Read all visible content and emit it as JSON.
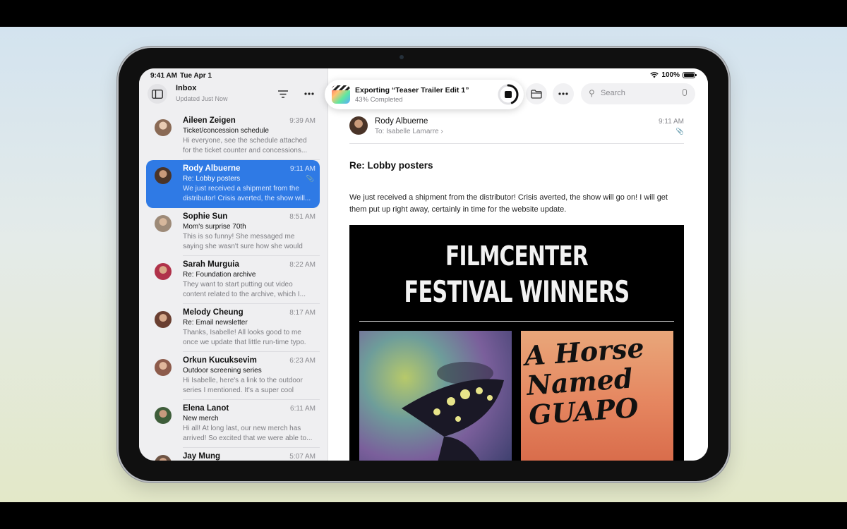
{
  "status": {
    "time": "9:41 AM",
    "date": "Tue Apr 1",
    "battery": "100%"
  },
  "sidebar": {
    "title": "Inbox",
    "subtitle": "Updated Just Now",
    "icons": {
      "sidebar_toggle": "sidebar-icon",
      "filter": "filter-icon",
      "more": "ellipsis-icon"
    }
  },
  "mails": [
    {
      "sender": "Aileen Zeigen",
      "time": "9:39 AM",
      "subject": "Ticket/concession schedule",
      "preview": "Hi everyone, see the schedule attached for the ticket counter and concessions...",
      "avatar_color": "#8a6a55",
      "selected": false,
      "attachment": false
    },
    {
      "sender": "Rody Albuerne",
      "time": "9:11 AM",
      "subject": "Re: Lobby posters",
      "preview": "We just received a shipment from the distributor! Crisis averted, the show will...",
      "avatar_color": "#6b4b3a",
      "selected": true,
      "attachment": true
    },
    {
      "sender": "Sophie Sun",
      "time": "8:51 AM",
      "subject": "Mom's surprise 70th",
      "preview": "This is so funny! She messaged me saying she wasn't sure how she would spend...",
      "avatar_color": "#b9a38d",
      "selected": false,
      "attachment": false
    },
    {
      "sender": "Sarah Murguia",
      "time": "8:22 AM",
      "subject": "Re: Foundation archive",
      "preview": "They want to start putting out video content related to the archive, which I...",
      "avatar_color": "#b0324a",
      "selected": false,
      "attachment": false
    },
    {
      "sender": "Melody Cheung",
      "time": "8:17 AM",
      "subject": "Re: Email newsletter",
      "preview": "Thanks, Isabelle! All looks good to me once we update that little run-time typo.",
      "avatar_color": "#7a4e3e",
      "selected": false,
      "attachment": false
    },
    {
      "sender": "Orkun Kucuksevim",
      "time": "6:23 AM",
      "subject": "Outdoor screening series",
      "preview": "Hi Isabelle, here's a link to the outdoor series I mentioned. It's a super cool initia...",
      "avatar_color": "#9b6a5a",
      "selected": false,
      "attachment": false
    },
    {
      "sender": "Elena Lanot",
      "time": "6:11 AM",
      "subject": "New merch",
      "preview": "Hi all! At long last, our new merch has arrived! So excited that we were able to...",
      "avatar_color": "#3e5d3a",
      "selected": false,
      "attachment": false
    },
    {
      "sender": "Jay Mung",
      "time": "5:07 AM",
      "subject": "",
      "preview": "",
      "avatar_color": "#6e5445",
      "selected": false,
      "attachment": false
    }
  ],
  "export": {
    "title": "Exporting “Teaser Trailer Edit 1”",
    "progress_text": "43% Completed",
    "progress": 0.43,
    "icon": "final-cut-pro-icon"
  },
  "toolbar": {
    "folder_icon": "folder-icon",
    "more_icon": "ellipsis-icon",
    "search_placeholder": "Search",
    "mic_icon": "microphone-icon"
  },
  "message": {
    "from": "Rody Albuerne",
    "to": "To: Isabelle Lamarre",
    "time": "9:11 AM",
    "subject": "Re: Lobby posters",
    "body": "We just received a shipment from the distributor! Crisis averted, the show will go on! I will get them put up right away, certainly in time for the website update.",
    "poster": {
      "brand": "FILMCENTER",
      "heading": "FESTIVAL WINNERS",
      "tile2_title": "A Horse Named GUAPO"
    }
  },
  "colors": {
    "selected": "#2f7ae5",
    "sidebar_bg": "#efeff1"
  }
}
